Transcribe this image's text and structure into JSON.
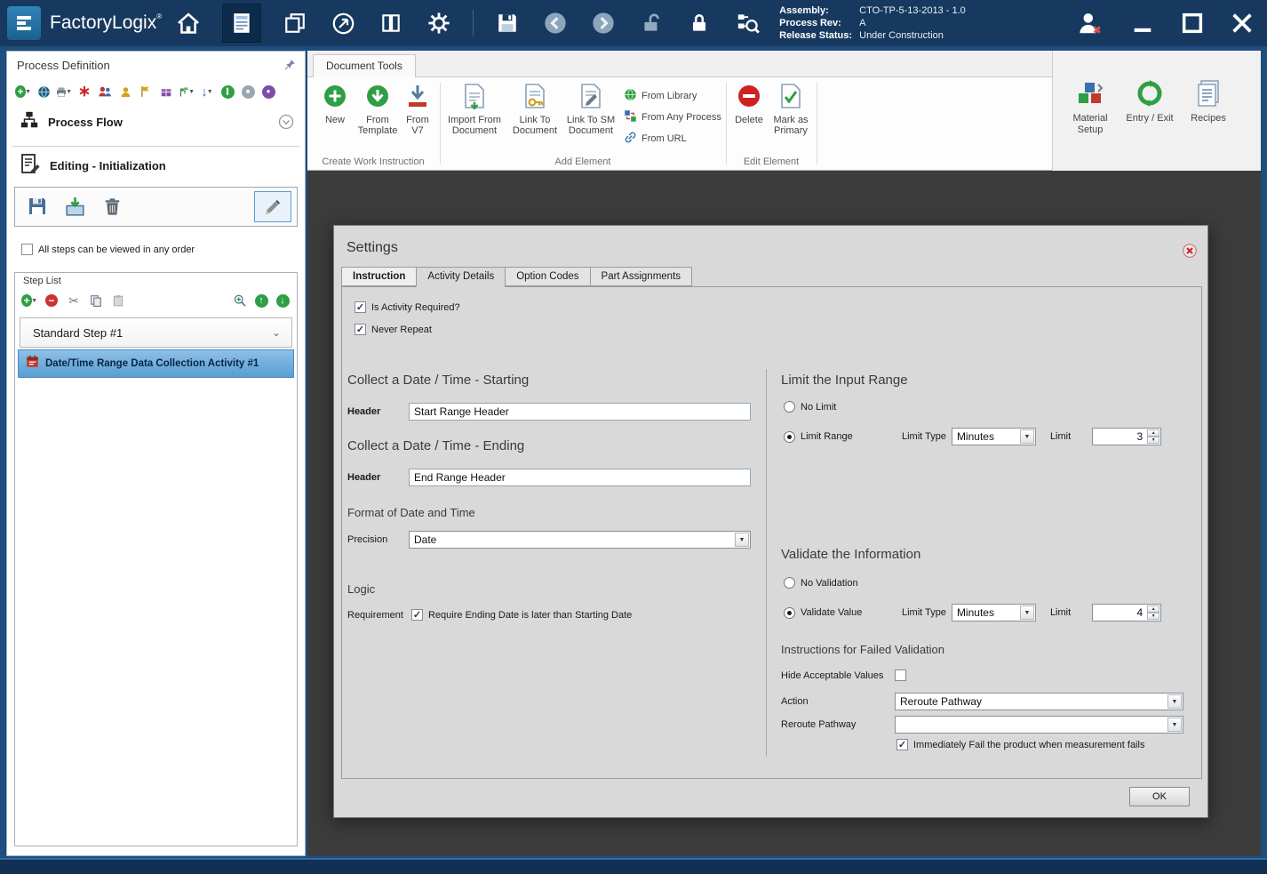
{
  "palette": {
    "titlebar_bg": "#17395f",
    "frame_bg": "#1e4d7e",
    "content_bg": "#3c3c3c",
    "selection_blue": "#5ea3d6",
    "accent_green": "#2f9e44",
    "accent_red": "#cc3333"
  },
  "titlebar": {
    "app_name": "FactoryLogix",
    "registered": "®",
    "assembly_label": "Assembly:",
    "assembly_value": "CTO-TP-5-13-2013 - 1.0",
    "process_rev_label": "Process Rev:",
    "process_rev_value": "A",
    "release_status_label": "Release Status:",
    "release_status_value": "Under Construction"
  },
  "sidebar": {
    "title": "Process Definition",
    "process_flow_label": "Process Flow",
    "editing_label": "Editing - Initialization",
    "any_order_label": "All steps can be viewed in any order",
    "step_list_title": "Step List",
    "step_label": "Standard Step #1",
    "activity_label": "Date/Time Range Data Collection Activity #1"
  },
  "ribbon": {
    "tab_label": "Document Tools",
    "create_group": {
      "label": "Create Work Instruction",
      "new_label": "New",
      "from_template_label": "From Template",
      "from_v7_label": "From V7"
    },
    "add_group": {
      "label": "Add Element",
      "import_label": "Import From Document",
      "link_doc_label": "Link To Document",
      "link_sm_label": "Link To SM Document",
      "from_library_label": "From Library",
      "from_any_process_label": "From Any Process",
      "from_url_label": "From URL"
    },
    "edit_group": {
      "label": "Edit Element",
      "delete_label": "Delete",
      "mark_primary_label": "Mark as Primary"
    },
    "right_panel": {
      "material_setup_label": "Material Setup",
      "entry_exit_label": "Entry / Exit",
      "recipes_label": "Recipes"
    }
  },
  "dialog": {
    "title": "Settings",
    "tabs": {
      "instruction": "Instruction",
      "activity_details": "Activity Details",
      "option_codes": "Option Codes",
      "part_assignments": "Part Assignments"
    },
    "is_activity_required_label": "Is Activity Required?",
    "never_repeat_label": "Never Repeat",
    "starting_heading": "Collect a Date / Time - Starting",
    "header_label": "Header",
    "start_header_value": "Start Range Header",
    "ending_heading": "Collect a Date / Time - Ending",
    "end_header_value": "End Range Header",
    "format_heading": "Format of Date and Time",
    "precision_label": "Precision",
    "precision_value": "Date",
    "logic_heading": "Logic",
    "requirement_label": "Requirement",
    "requirement_text": "Require Ending Date is later than Starting Date",
    "limit_heading": "Limit the Input Range",
    "no_limit_label": "No Limit",
    "limit_range_label": "Limit Range",
    "limit_type_label": "Limit Type",
    "limit_type_value": "Minutes",
    "limit_label": "Limit",
    "limit_value": "3",
    "validate_heading": "Validate the Information",
    "no_validation_label": "No Validation",
    "validate_value_label": "Validate Value",
    "validate_limit_type_value": "Minutes",
    "validate_limit_value": "4",
    "failed_heading": "Instructions for Failed Validation",
    "hide_acceptable_label": "Hide Acceptable Values",
    "action_label": "Action",
    "action_value": "Reroute Pathway",
    "reroute_label": "Reroute Pathway",
    "reroute_value": "",
    "fail_label": "Immediately Fail the product when measurement fails",
    "ok_label": "OK"
  }
}
